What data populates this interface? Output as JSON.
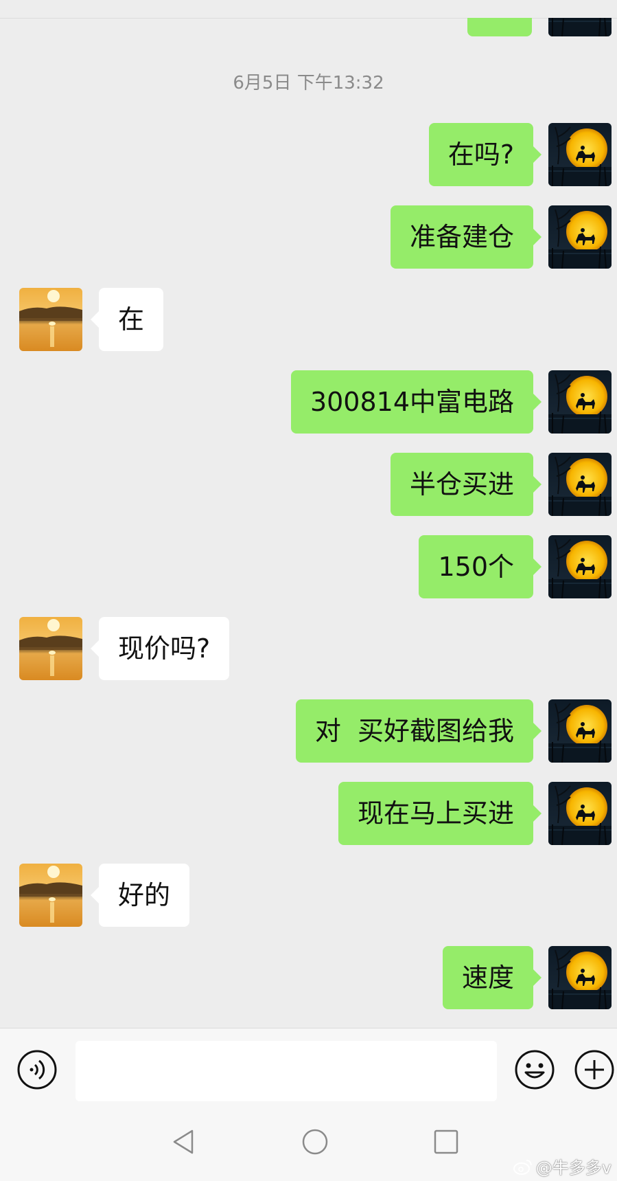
{
  "chat": {
    "timestamp": "6月5日 下午13:32",
    "messages": [
      {
        "side": "sent",
        "text": "在吗?"
      },
      {
        "side": "sent",
        "text": "准备建仓"
      },
      {
        "side": "recv",
        "text": "在"
      },
      {
        "side": "sent",
        "text": "300814中富电路"
      },
      {
        "side": "sent",
        "text": "半仓买进"
      },
      {
        "side": "sent",
        "text": "150个"
      },
      {
        "side": "recv",
        "text": "现价吗?"
      },
      {
        "side": "sent",
        "text": "对  买好截图给我"
      },
      {
        "side": "sent",
        "text": "现在马上买进"
      },
      {
        "side": "recv",
        "text": "好的"
      },
      {
        "side": "sent",
        "text": "速度"
      }
    ]
  },
  "input_bar": {
    "placeholder": "",
    "value": "",
    "icons": [
      "voice-icon",
      "emoji-icon",
      "plus-icon"
    ]
  },
  "nav_bar": {
    "icons": [
      "back-triangle-icon",
      "home-circle-icon",
      "recent-square-icon"
    ]
  },
  "watermark": {
    "text": "@牛多多v",
    "icon": "weibo-logo-icon"
  },
  "colors": {
    "background": "#ededed",
    "sent_bubble": "#95ec69",
    "recv_bubble": "#ffffff",
    "timestamp": "#8a8a8a"
  }
}
